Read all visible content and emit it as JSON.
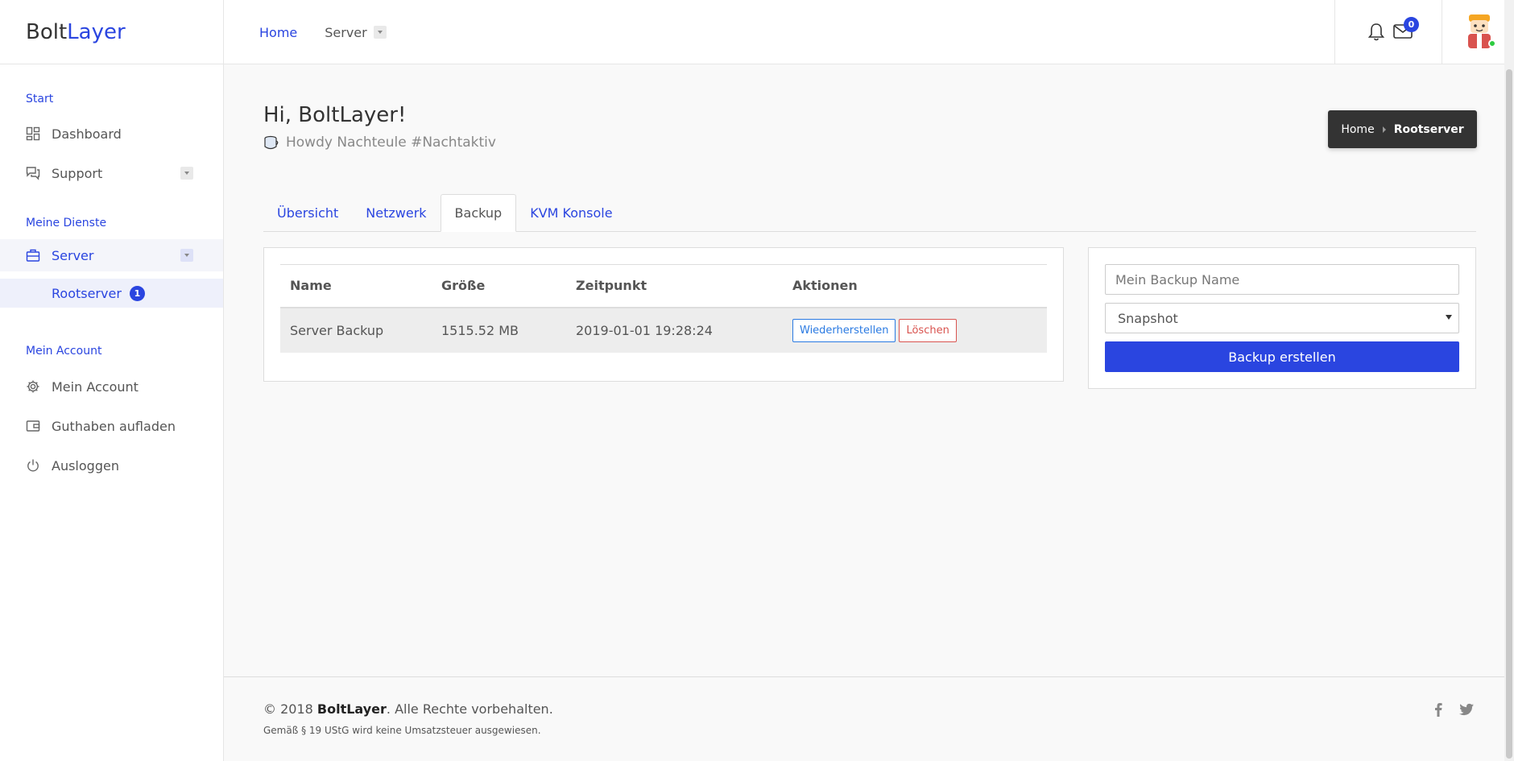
{
  "brand": {
    "part1": "Bolt",
    "part2": "Layer"
  },
  "topnav": {
    "home": "Home",
    "server": "Server"
  },
  "notifications": {
    "mail_count": "0"
  },
  "sidebar": {
    "start_heading": "Start",
    "dashboard": "Dashboard",
    "support": "Support",
    "services_heading": "Meine Dienste",
    "server": "Server",
    "rootserver": "Rootserver",
    "rootserver_count": "1",
    "account_heading": "Mein Account",
    "my_account": "Mein Account",
    "topup": "Guthaben aufladen",
    "logout": "Ausloggen"
  },
  "header": {
    "title": "Hi, BoltLayer!",
    "subtitle": "Howdy Nachteule #Nachtaktiv"
  },
  "breadcrumb": {
    "home": "Home",
    "current": "Rootserver"
  },
  "tabs": [
    "Übersicht",
    "Netzwerk",
    "Backup",
    "KVM Konsole"
  ],
  "active_tab": "Backup",
  "backup_table": {
    "headers": [
      "Name",
      "Größe",
      "Zeitpunkt",
      "Aktionen"
    ],
    "rows": [
      {
        "name": "Server Backup",
        "size": "1515.52 MB",
        "time": "2019-01-01 19:28:24",
        "restore": "Wiederherstellen",
        "delete": "Löschen"
      }
    ]
  },
  "create_form": {
    "name_placeholder": "Mein Backup Name",
    "type_value": "Snapshot",
    "submit": "Backup erstellen"
  },
  "footer": {
    "copy_prefix": "© 2018 ",
    "copy_brand": "BoltLayer",
    "copy_suffix": ". Alle Rechte vorbehalten.",
    "tax_note": "Gemäß § 19 UStG wird keine Umsatzsteuer ausgewiesen."
  },
  "colors": {
    "accent": "#2a45e0",
    "danger": "#d9534f",
    "info": "#2a7ae2",
    "dark": "#333333"
  }
}
